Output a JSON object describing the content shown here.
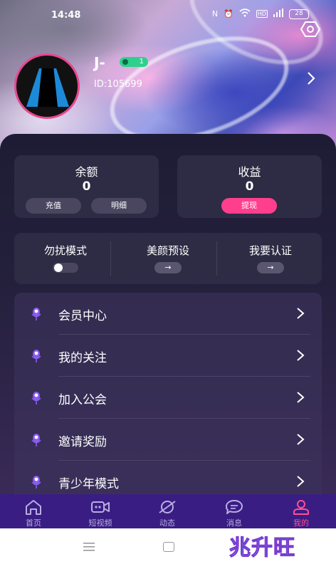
{
  "status_bar": {
    "time": "14:48",
    "battery": "28",
    "icons": [
      "nfc-icon",
      "alarm-icon",
      "wifi-icon",
      "hd-icon",
      "signal-icon",
      "battery-icon"
    ]
  },
  "profile": {
    "username": "J-",
    "level": "1",
    "user_id": "ID:105699"
  },
  "wallet": {
    "balance_title": "余额",
    "balance_value": "0",
    "recharge_label": "充值",
    "detail_label": "明细",
    "earnings_title": "收益",
    "earnings_value": "0",
    "withdraw_label": "提现"
  },
  "modes": [
    {
      "label": "勿扰模式",
      "control": "toggle",
      "on": false
    },
    {
      "label": "美颜预设",
      "control": "arrow",
      "symbol": "→"
    },
    {
      "label": "我要认证",
      "control": "arrow",
      "symbol": "→"
    }
  ],
  "menu": [
    {
      "label": "会员中心"
    },
    {
      "label": "我的关注"
    },
    {
      "label": "加入公会"
    },
    {
      "label": "邀请奖励"
    },
    {
      "label": "青少年模式"
    }
  ],
  "tabs": [
    {
      "label": "首页",
      "icon": "home-icon",
      "active": false
    },
    {
      "label": "短视频",
      "icon": "video-camera-icon",
      "active": false
    },
    {
      "label": "动态",
      "icon": "planet-icon",
      "active": false
    },
    {
      "label": "消息",
      "icon": "chat-bubble-icon",
      "active": false
    },
    {
      "label": "我的",
      "icon": "user-icon",
      "active": true
    }
  ],
  "watermark": "兆升旺",
  "colors": {
    "accent_pink": "#ff3f8e",
    "tabbar": "#3a1d83",
    "level_badge": "#2fd08d"
  }
}
